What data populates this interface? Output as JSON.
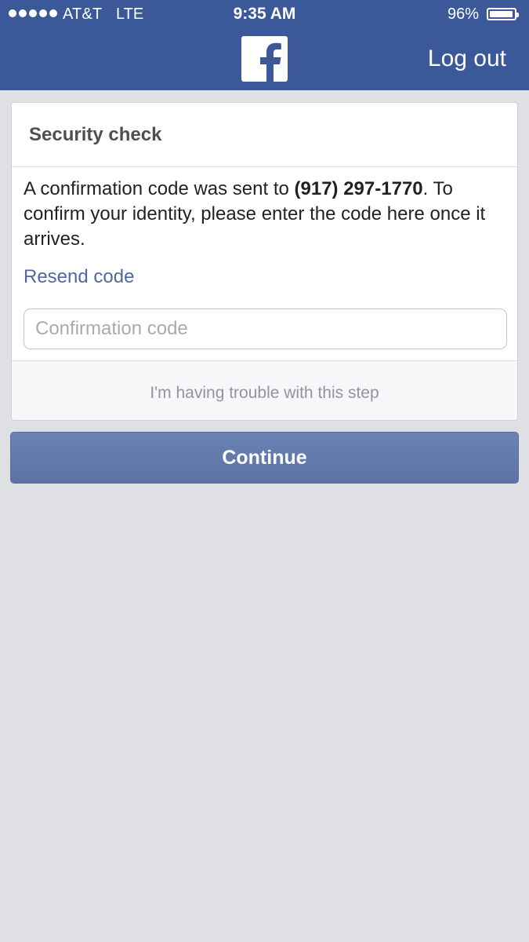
{
  "status_bar": {
    "signal_dots": 5,
    "carrier": "AT&T",
    "network": "LTE",
    "time": "9:35 AM",
    "battery_percent_label": "96%",
    "battery_level": 0.96
  },
  "header": {
    "logo_icon": "facebook-f-icon",
    "logout_label": "Log out"
  },
  "security_check": {
    "title": "Security check",
    "message_before": "A confirmation code was sent to ",
    "phone_number": "(917) 297-1770",
    "message_after": ". To confirm your identity, please enter the code here once it arrives.",
    "resend_label": "Resend code",
    "code_input": {
      "value": "",
      "placeholder": "Confirmation code"
    },
    "trouble_label": "I'm having trouble with this step"
  },
  "actions": {
    "continue_label": "Continue"
  },
  "colors": {
    "brand_blue": "#3b5998",
    "link_blue": "#4e69a2",
    "continue_button": "#6a82b3",
    "background": "#dfe0e4"
  }
}
